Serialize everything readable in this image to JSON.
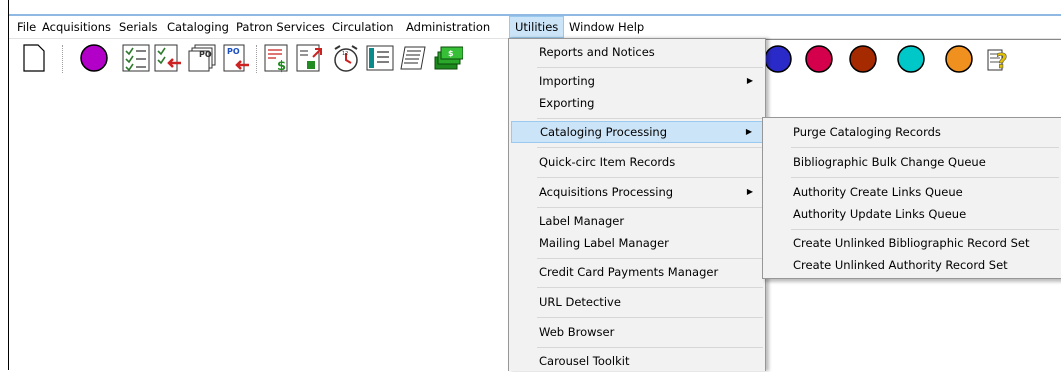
{
  "menubar": {
    "items": [
      "File",
      "Acquisitions",
      "Serials",
      "Cataloging",
      "Patron Services",
      "Circulation",
      "Administration",
      "Utilities",
      "Window",
      "Help"
    ],
    "active": "Utilities"
  },
  "toolbar": {
    "icons": [
      {
        "name": "new-document-icon",
        "color": "#ffffff"
      },
      {
        "name": "purple-circle-icon",
        "color": "#b200c8"
      },
      {
        "name": "checklist-icon",
        "color": "#2f7a2f"
      },
      {
        "name": "checklist-arrow-icon",
        "color": "#cc2222"
      },
      {
        "name": "po-stack-icon",
        "color": "#555555"
      },
      {
        "name": "po-arrow-icon",
        "color": "#1a4fc0"
      },
      {
        "name": "invoice-dollar-icon",
        "color": "#228b22"
      },
      {
        "name": "invoice-arrow-icon",
        "color": "#cc2222"
      },
      {
        "name": "alarm-clock-icon",
        "color": "#cc2222"
      },
      {
        "name": "catalog-card-icon",
        "color": "#0a8a8a"
      },
      {
        "name": "register-icon",
        "color": "#333333"
      },
      {
        "name": "money-stack-icon",
        "color": "#1e8a1e"
      }
    ],
    "right_icons": [
      {
        "name": "blue-circle-icon",
        "color": "#2a2ac8"
      },
      {
        "name": "crimson-circle-icon",
        "color": "#d4004c"
      },
      {
        "name": "brown-circle-icon",
        "color": "#a52a00"
      },
      {
        "name": "teal-circle-icon",
        "color": "#00c8c8"
      },
      {
        "name": "orange-circle-icon",
        "color": "#f0901e"
      },
      {
        "name": "help-question-icon",
        "color": "#e0c000"
      }
    ]
  },
  "utilities_menu": {
    "items": [
      {
        "label": "Reports and Notices",
        "submenu": false
      },
      {
        "label": "Importing",
        "submenu": true
      },
      {
        "label": "Exporting",
        "submenu": false
      },
      {
        "label": "Cataloging Processing",
        "submenu": true,
        "highlighted": true
      },
      {
        "label": "Quick-circ Item Records",
        "submenu": false
      },
      {
        "label": "Acquisitions Processing",
        "submenu": true
      },
      {
        "label": "Label Manager",
        "submenu": false
      },
      {
        "label": "Mailing Label Manager",
        "submenu": false
      },
      {
        "label": "Credit Card Payments Manager",
        "submenu": false
      },
      {
        "label": "URL Detective",
        "submenu": false
      },
      {
        "label": "Web Browser",
        "submenu": false
      },
      {
        "label": "Carousel Toolkit",
        "submenu": false
      }
    ]
  },
  "cataloging_submenu": {
    "items": [
      "Purge Cataloging Records",
      "Bibliographic Bulk Change Queue",
      "Authority Create Links Queue",
      "Authority Update Links Queue",
      "Create Unlinked Bibliographic Record Set",
      "Create Unlinked Authority Record Set"
    ]
  },
  "colors": {
    "highlight": "#cce4f7",
    "highlight_border": "#99c9ef",
    "menu_bg": "#f2f2f2"
  }
}
